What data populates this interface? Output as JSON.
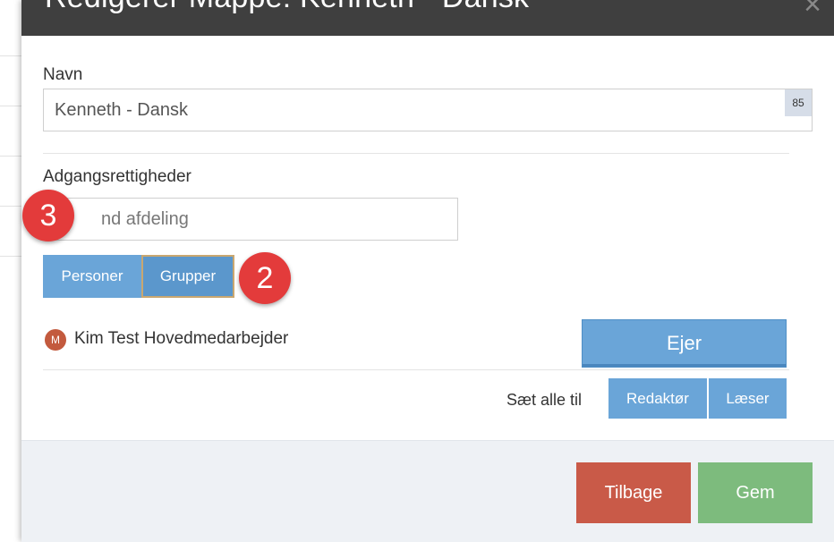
{
  "modal": {
    "title": "Redigerer Mappe: Kenneth - Dansk",
    "close_glyph": "×"
  },
  "form": {
    "name_label": "Navn",
    "name_value": "Kenneth - Dansk",
    "name_counter": "85",
    "access_label": "Adgangsrettigheder",
    "search_placeholder": "nd afdeling",
    "tabs": [
      {
        "label": "Personer",
        "selected": false
      },
      {
        "label": "Grupper",
        "selected": true
      }
    ]
  },
  "members": [
    {
      "avatar_initial": "M",
      "name": "Kim Test Hovedmedarbejder",
      "role": "Ejer"
    }
  ],
  "set_all": {
    "label": "Sæt alle til",
    "options": [
      "Redaktør",
      "Læser"
    ]
  },
  "footer": {
    "back_label": "Tilbage",
    "save_label": "Gem"
  },
  "annotations": {
    "step_3": "3",
    "step_2": "2"
  },
  "colors": {
    "header": "#3f3f3f",
    "primary_blue": "#6aa5d8",
    "danger": "#c95a48",
    "success": "#7dbb7d",
    "badge": "#e33b3b"
  }
}
